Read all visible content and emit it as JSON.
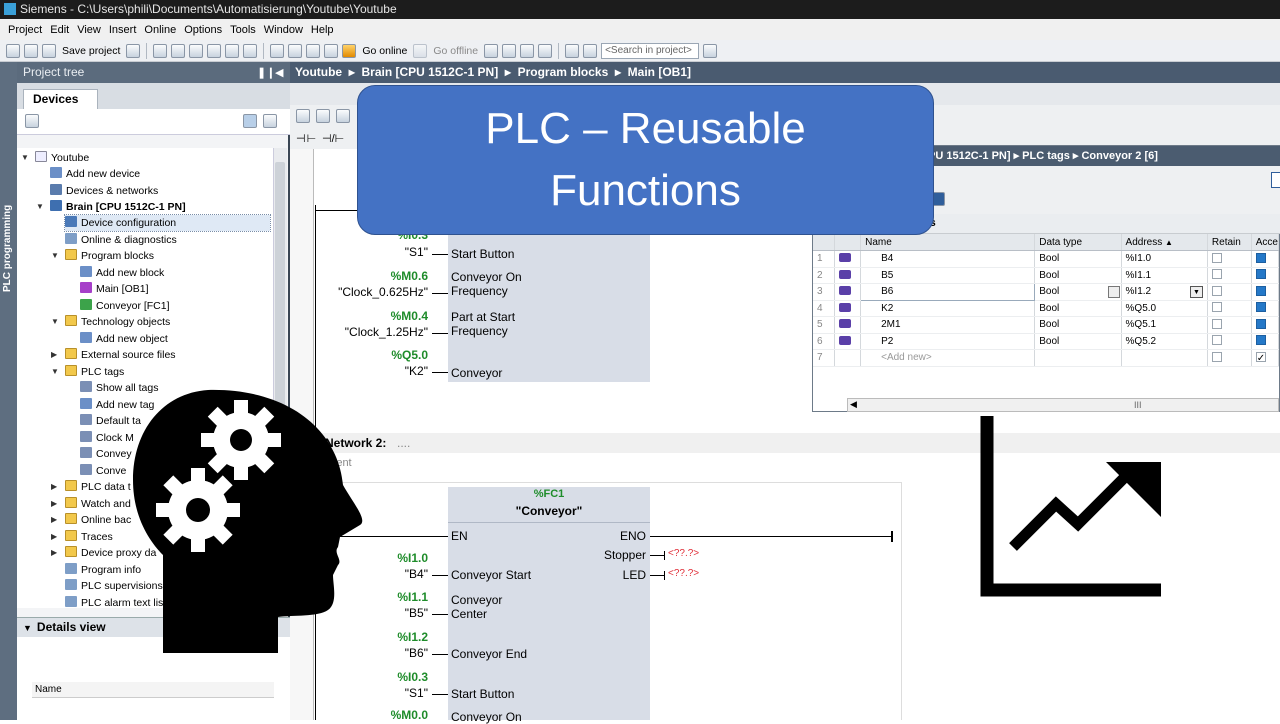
{
  "window": {
    "title": "Siemens  -  C:\\Users\\phili\\Documents\\Automatisierung\\Youtube\\Youtube"
  },
  "menu": [
    "Project",
    "Edit",
    "View",
    "Insert",
    "Online",
    "Options",
    "Tools",
    "Window",
    "Help"
  ],
  "toolbar": {
    "save": "Save project",
    "go_online": "Go online",
    "go_offline": "Go offline",
    "search_placeholder": "<Search in project>"
  },
  "side_strip": {
    "label": "PLC programming"
  },
  "project_tree": {
    "title": "Project tree",
    "tab": "Devices",
    "items": [
      {
        "label": "Youtube"
      },
      {
        "label": "Add new device"
      },
      {
        "label": "Devices & networks"
      },
      {
        "label": "Brain [CPU 1512C-1 PN]"
      },
      {
        "label": "Device configuration"
      },
      {
        "label": "Online & diagnostics"
      },
      {
        "label": "Program blocks"
      },
      {
        "label": "Add new block"
      },
      {
        "label": "Main [OB1]"
      },
      {
        "label": "Conveyor [FC1]"
      },
      {
        "label": "Technology objects"
      },
      {
        "label": "Add new object"
      },
      {
        "label": "External source files"
      },
      {
        "label": "PLC tags"
      },
      {
        "label": "Show all tags"
      },
      {
        "label": "Add new tag"
      },
      {
        "label": "Default ta"
      },
      {
        "label": "Clock M"
      },
      {
        "label": "Convey"
      },
      {
        "label": "Conve"
      },
      {
        "label": "PLC data t"
      },
      {
        "label": "Watch and"
      },
      {
        "label": "Online bac"
      },
      {
        "label": "Traces"
      },
      {
        "label": "Device proxy da"
      },
      {
        "label": "Program info"
      },
      {
        "label": "PLC supervisions &"
      },
      {
        "label": "PLC alarm text list"
      }
    ]
  },
  "details_view": {
    "title": "Details view",
    "col_name": "Name"
  },
  "editor": {
    "breadcrumb": [
      "Youtube",
      "Brain [CPU 1512C-1 PN]",
      "Program blocks",
      "Main [OB1]"
    ],
    "network1": {
      "rows": [
        {
          "addr": "%I0.3",
          "sym": "\"S1\"",
          "param": "Start Button"
        },
        {
          "addr": "%M0.6",
          "sym": "\"Clock_0.625Hz\"",
          "param": "Conveyor On\nFrequency"
        },
        {
          "addr": "%M0.4",
          "sym": "\"Clock_1.25Hz\"",
          "param": "Part at Start\nFrequency"
        },
        {
          "addr": "%Q5.0",
          "sym": "\"K2\"",
          "param": "Conveyor"
        }
      ]
    },
    "network2": {
      "title": "Network 2:",
      "dots": "....",
      "comment": "mment",
      "block_addr": "%FC1",
      "block_name": "\"Conveyor\"",
      "en": "EN",
      "eno": "ENO",
      "outputs": [
        {
          "param": "Stopper",
          "val": "<??.?>"
        },
        {
          "param": "LED",
          "val": "<??.?>"
        }
      ],
      "inputs": [
        {
          "addr": "%I1.0",
          "sym": "\"B4\"",
          "param": "Conveyor Start"
        },
        {
          "addr": "%I1.1",
          "sym": "\"B5\"",
          "param": "Conveyor\nCenter"
        },
        {
          "addr": "%I1.2",
          "sym": "\"B6\"",
          "param": "Conveyor End"
        },
        {
          "addr": "%I0.3",
          "sym": "\"S1\"",
          "param": "Start Button"
        },
        {
          "addr": "%M0.0",
          "sym": "",
          "param": "Conveyor On"
        }
      ]
    }
  },
  "tag_table": {
    "breadcrumb": "PU 1512C-1 PN]  ▸  PLC tags  ▸  Conveyor 2 [6]",
    "section": "ts",
    "headers": {
      "name": "Name",
      "type": "Data type",
      "address": "Address",
      "retain": "Retain",
      "access": "Acce"
    },
    "rows": [
      {
        "n": "1",
        "name": "B4",
        "type": "Bool",
        "addr": "%I1.0"
      },
      {
        "n": "2",
        "name": "B5",
        "type": "Bool",
        "addr": "%I1.1"
      },
      {
        "n": "3",
        "name": "B6",
        "type": "Bool",
        "addr": "%I1.2"
      },
      {
        "n": "4",
        "name": "K2",
        "type": "Bool",
        "addr": "%Q5.0"
      },
      {
        "n": "5",
        "name": "2M1",
        "type": "Bool",
        "addr": "%Q5.1"
      },
      {
        "n": "6",
        "name": "P2",
        "type": "Bool",
        "addr": "%Q5.2"
      },
      {
        "n": "7",
        "name": "<Add new>",
        "type": "",
        "addr": ""
      }
    ],
    "scroll_mark": "III"
  },
  "banner": {
    "line1": "PLC – Reusable",
    "line2": "Functions"
  },
  "colors": {
    "accent_banner": "#4472c4",
    "address_green": "#1e8c2a",
    "panel_header": "#5b6b7d",
    "invalid_red": "#e0303a"
  }
}
